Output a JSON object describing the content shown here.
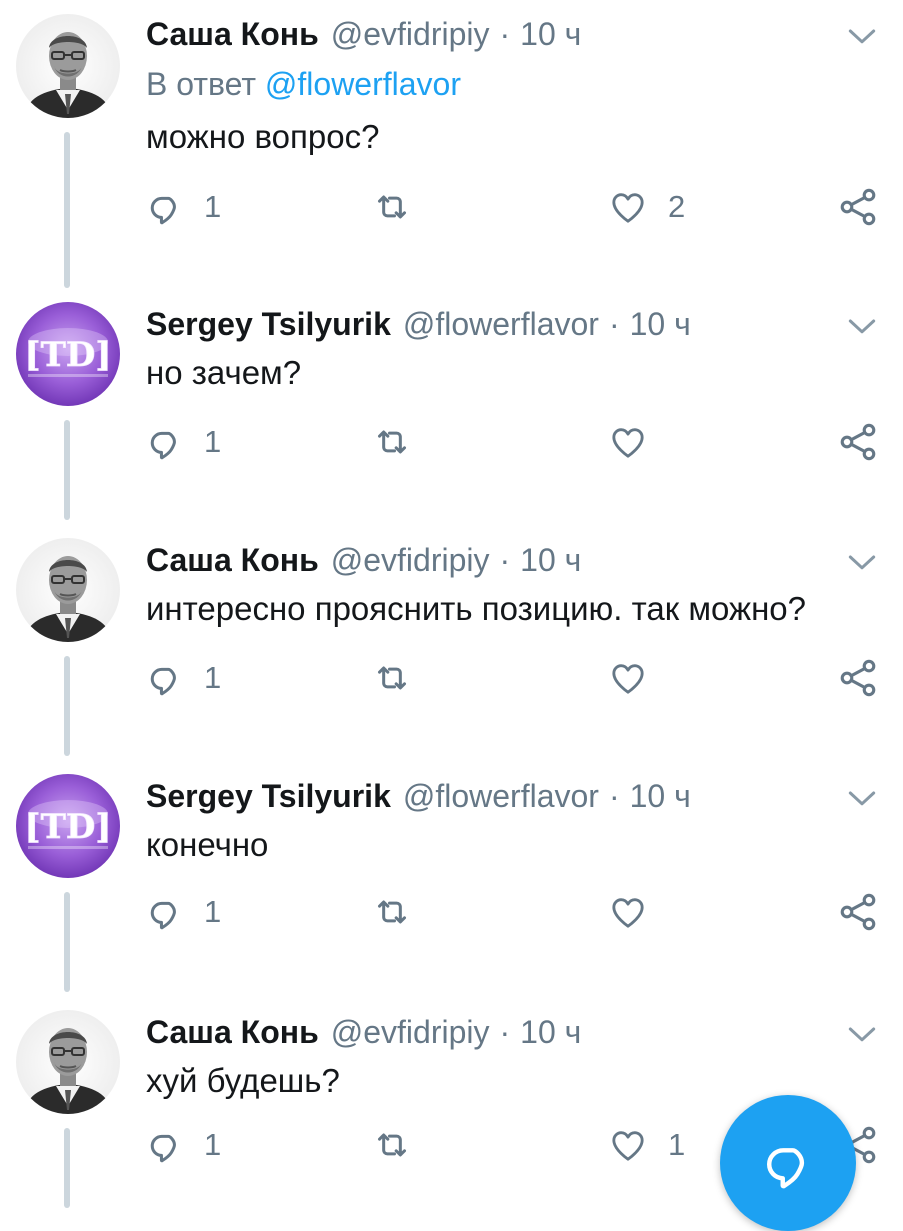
{
  "tweets": [
    {
      "name": "Саша Конь",
      "handle": "@evfidripiy",
      "separator": "·",
      "time": "10 ч",
      "reply_label": "В ответ",
      "reply_mention": "@flowerflavor",
      "text": "можно вопрос?",
      "reply_count": "1",
      "retweet_count": "",
      "like_count": "2",
      "avatar": "photo-man-glasses"
    },
    {
      "name": "Sergey Tsilyurik",
      "handle": "@flowerflavor",
      "separator": "·",
      "time": "10 ч",
      "text": "но зачем?",
      "reply_count": "1",
      "retweet_count": "",
      "like_count": "",
      "avatar": "purple-td-logo",
      "avatar_text": "[TD]"
    },
    {
      "name": "Саша Конь",
      "handle": "@evfidripiy",
      "separator": "·",
      "time": "10 ч",
      "text": "интересно прояснить позицию. так можно?",
      "reply_count": "1",
      "retweet_count": "",
      "like_count": "",
      "avatar": "photo-man-glasses"
    },
    {
      "name": "Sergey Tsilyurik",
      "handle": "@flowerflavor",
      "separator": "·",
      "time": "10 ч",
      "text": "конечно",
      "reply_count": "1",
      "retweet_count": "",
      "like_count": "",
      "avatar": "purple-td-logo",
      "avatar_text": "[TD]"
    },
    {
      "name": "Саша Конь",
      "handle": "@evfidripiy",
      "separator": "·",
      "time": "10 ч",
      "text": "хуй будешь?",
      "reply_count": "1",
      "retweet_count": "",
      "like_count": "1",
      "avatar": "photo-man-glasses"
    }
  ],
  "icons": {
    "reply": "reply-icon",
    "retweet": "retweet-icon",
    "like": "heart-icon",
    "share": "share-icon",
    "menu": "chevron-down-icon",
    "compose": "compose-reply-icon"
  },
  "colors": {
    "text": "#14171a",
    "secondary": "#657786",
    "accent": "#1da1f2",
    "thread_line": "#ccd6dd"
  }
}
